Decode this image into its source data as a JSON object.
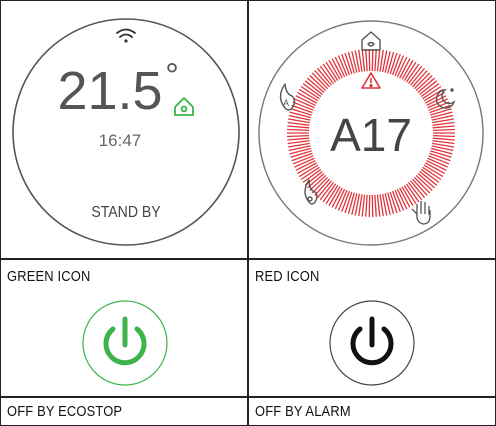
{
  "thermostat": {
    "temperature": "21.5",
    "degree": "°",
    "time": "16:47",
    "status": "STAND BY"
  },
  "alarm_display": {
    "code": "A17"
  },
  "legend": {
    "green_icon_label": "GREEN ICON",
    "red_icon_label": "RED ICON",
    "off_ecostop_label": "OFF BY ECOSTOP",
    "off_alarm_label": "OFF BY ALARM"
  },
  "colors": {
    "green": "#3cb44a",
    "red": "#e0343a",
    "dark": "#111111",
    "grey": "#666666"
  },
  "icons": [
    "wifi-icon",
    "home-icon",
    "warning-icon",
    "moon-icon",
    "hand-icon",
    "flame-icon",
    "auto-flame-icon",
    "power-icon"
  ]
}
